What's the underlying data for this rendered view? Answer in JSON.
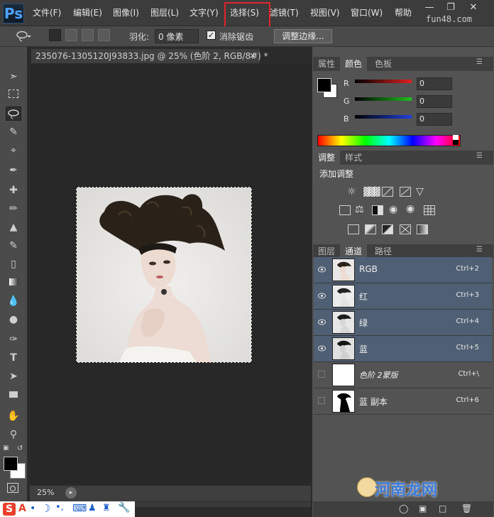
{
  "app": {
    "logo": "Ps",
    "site": "fun48.com"
  },
  "menu": {
    "items": [
      "文件(F)",
      "编辑(E)",
      "图像(I)",
      "图层(L)",
      "文字(Y)",
      "选择(S)",
      "滤镜(T)",
      "视图(V)",
      "窗口(W)",
      "帮助"
    ],
    "highlight_color": "#e0252b"
  },
  "options": {
    "feather_label": "羽化:",
    "feather_value": "0 像素",
    "antialias_label": "消除锯齿",
    "antialias_checked": true,
    "refine_edge": "调整边缘..."
  },
  "document": {
    "tab_title": "235076-1305120J93833.jpg @ 25% (色阶 2, RGB/8#) *",
    "tab_close": "×",
    "zoom": "25%"
  },
  "color_panel": {
    "tabs": [
      "属性",
      "颜色",
      "色板"
    ],
    "active_tab": "颜色",
    "channels": [
      {
        "label": "R",
        "value": "0",
        "color": "#e02020"
      },
      {
        "label": "G",
        "value": "0",
        "color": "#20c020"
      },
      {
        "label": "B",
        "value": "0",
        "color": "#2040e0"
      }
    ]
  },
  "adjust_panel": {
    "tabs": [
      "调整",
      "样式"
    ],
    "active_tab": "调整",
    "title": "添加调整",
    "icons": [
      "brightness-icon",
      "levels-icon",
      "curves-icon",
      "exposure-icon",
      "vibrance-icon",
      "hue-saturation-icon",
      "color-balance-icon",
      "black-white-icon",
      "photo-filter-icon",
      "channel-mixer-icon",
      "color-lookup-icon",
      "invert-icon",
      "posterize-icon",
      "threshold-icon",
      "selective-color-icon",
      "gradient-map-icon"
    ]
  },
  "channels_panel": {
    "tabs": [
      "图层",
      "通道",
      "路径"
    ],
    "active_tab": "通道",
    "rows": [
      {
        "name": "RGB",
        "shortcut": "Ctrl+2",
        "visible": true,
        "selected": true,
        "italic": false
      },
      {
        "name": "红",
        "shortcut": "Ctrl+3",
        "visible": true,
        "selected": true,
        "italic": false
      },
      {
        "name": "绿",
        "shortcut": "Ctrl+4",
        "visible": true,
        "selected": true,
        "italic": false
      },
      {
        "name": "蓝",
        "shortcut": "Ctrl+5",
        "visible": true,
        "selected": true,
        "italic": false
      },
      {
        "name": "色阶 2蒙版",
        "shortcut": "Ctrl+\\",
        "visible": false,
        "selected": false,
        "italic": true
      },
      {
        "name": "蓝 副本",
        "shortcut": "Ctrl+6",
        "visible": false,
        "selected": false,
        "italic": false
      }
    ]
  },
  "watermark": "河南龙网"
}
